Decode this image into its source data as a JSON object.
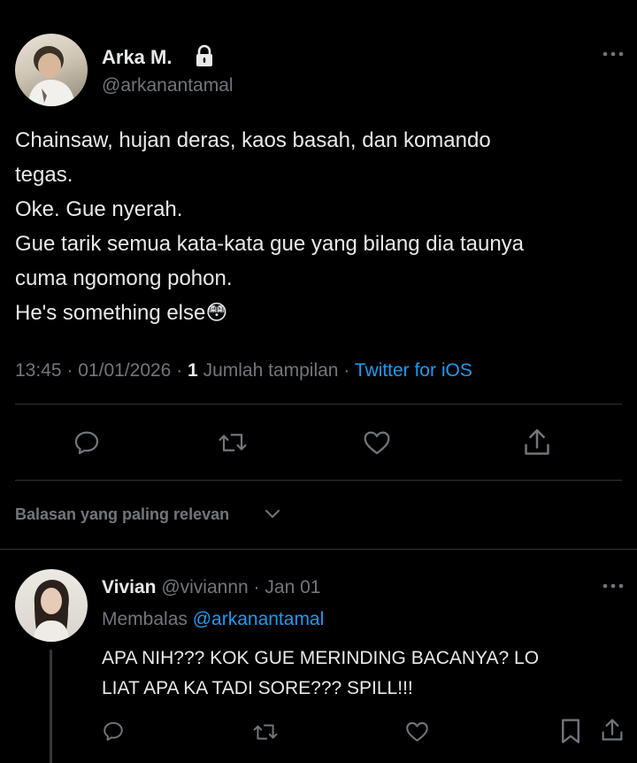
{
  "tweet": {
    "author_name": "Arka M.",
    "author_handle": "@arkanantamal",
    "lines": [
      "Chainsaw, hujan deras, kaos basah, dan komando",
      "tegas.",
      "Oke. Gue nyerah.",
      "Gue tarik semua kata-kata gue yang bilang dia taunya",
      "cuma ngomong pohon.",
      "He's something else"
    ],
    "emoji": "😳",
    "meta": {
      "time": "13:45",
      "sep1": "·",
      "date": "01/01/2026",
      "sep2": "·",
      "views_count": "1",
      "views_label": "Jumlah tampilan",
      "sep3": "·",
      "source": "Twitter for iOS"
    }
  },
  "sort": {
    "label": "Balasan yang paling relevan"
  },
  "reply": {
    "author_name": "Vivian",
    "author_handle": "@viviannn",
    "sep": "·",
    "date": "Jan 01",
    "replying_prefix": "Membalas",
    "replying_handle": "@arkanantamal",
    "lines": [
      "APA NIH??? KOK GUE MERINDING BACANYA? LO",
      "LIAT APA KA TADI SORE??? SPILL!!!"
    ]
  },
  "colors": {
    "background": "#000000",
    "text": "#e7e9ea",
    "muted": "#71767b",
    "accent": "#1d9bf0",
    "divider": "#2f3336"
  },
  "icons": [
    "more-icon",
    "lock-icon",
    "reply-icon",
    "retweet-icon",
    "like-icon",
    "share-icon",
    "chevron-down-icon",
    "bookmark-icon"
  ]
}
